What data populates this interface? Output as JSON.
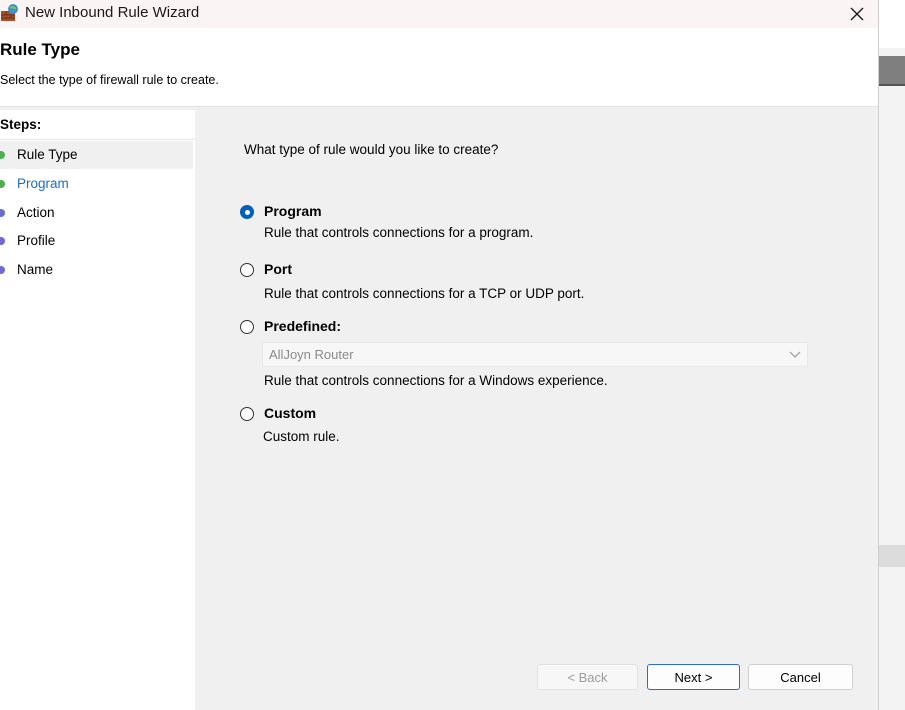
{
  "window": {
    "title": "New Inbound Rule Wizard"
  },
  "header": {
    "title": "Rule Type",
    "subtitle": "Select the type of firewall rule to create."
  },
  "steps": {
    "label": "Steps:",
    "items": [
      {
        "label": "Rule Type",
        "status": "current",
        "dot_color": "#4caf50",
        "text_color": "#000000"
      },
      {
        "label": "Program",
        "status": "next",
        "dot_color": "#4caf50",
        "text_color": "#1a6fc0"
      },
      {
        "label": "Action",
        "status": "pending",
        "dot_color": "#6b6bd6",
        "text_color": "#000000"
      },
      {
        "label": "Profile",
        "status": "pending",
        "dot_color": "#6b6bd6",
        "text_color": "#000000"
      },
      {
        "label": "Name",
        "status": "pending",
        "dot_color": "#6b6bd6",
        "text_color": "#000000"
      }
    ]
  },
  "main": {
    "question": "What type of rule would you like to create?",
    "options": [
      {
        "label": "Program",
        "description": "Rule that controls connections for a program.",
        "selected": true
      },
      {
        "label": "Port",
        "description": "Rule that controls connections for a TCP or UDP port.",
        "selected": false
      },
      {
        "label": "Predefined:",
        "description": "Rule that controls connections for a Windows experience.",
        "selected": false
      },
      {
        "label": "Custom",
        "description": "Custom rule.",
        "selected": false
      }
    ],
    "predefined_dropdown": {
      "value": "AllJoyn Router",
      "enabled": false
    }
  },
  "buttons": {
    "back": "< Back",
    "next": "Next >",
    "cancel": "Cancel"
  },
  "colors": {
    "accent": "#005fb8",
    "link": "#1a6fc0"
  }
}
